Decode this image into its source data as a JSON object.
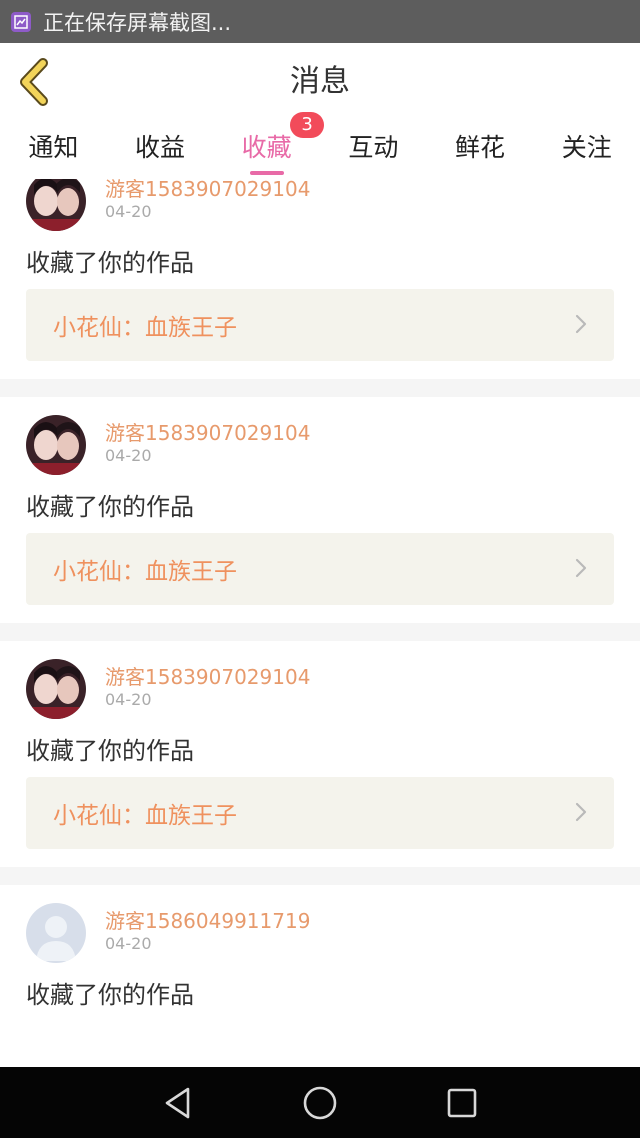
{
  "status_bar": {
    "text": "正在保存屏幕截图...",
    "icon": "screenshot-icon"
  },
  "header": {
    "title": "消息",
    "back_icon": "chevron-left-icon"
  },
  "tabs": [
    {
      "label": "通知",
      "active": false
    },
    {
      "label": "收益",
      "active": false
    },
    {
      "label": "收藏",
      "active": true,
      "badge": "3"
    },
    {
      "label": "互动",
      "active": false
    },
    {
      "label": "鲜花",
      "active": false
    },
    {
      "label": "关注",
      "active": false
    }
  ],
  "messages": [
    {
      "user": "游客1583907029104",
      "date": "04-20",
      "text": "收藏了你的作品",
      "work": "小花仙：血族王子",
      "avatar": "photo"
    },
    {
      "user": "游客1583907029104",
      "date": "04-20",
      "text": "收藏了你的作品",
      "work": "小花仙：血族王子",
      "avatar": "photo"
    },
    {
      "user": "游客1583907029104",
      "date": "04-20",
      "text": "收藏了你的作品",
      "work": "小花仙：血族王子",
      "avatar": "photo"
    },
    {
      "user": "游客1586049911719",
      "date": "04-20",
      "text": "收藏了你的作品",
      "avatar": "default"
    }
  ],
  "nav_bar": {
    "icons": [
      "back-triangle-icon",
      "home-circle-icon",
      "recents-square-icon"
    ]
  },
  "colors": {
    "accent": "#e86aa7",
    "username": "#e79a6c",
    "work_title": "#ef915e",
    "badge": "#f24b5a"
  }
}
